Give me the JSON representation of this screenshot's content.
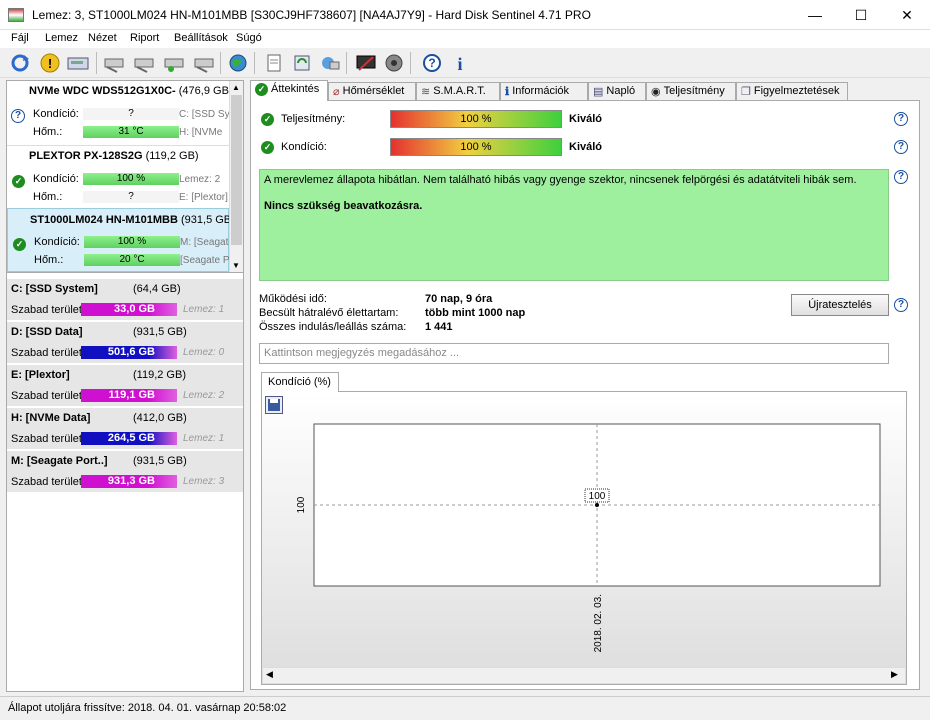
{
  "window": {
    "title": "Lemez: 3, ST1000LM024 HN-M101MBB [S30CJ9HF738607]  [NA4AJ7Y9]  -  Hard Disk Sentinel 4.71 PRO",
    "minimize": "—",
    "maximize": "☐",
    "close": "✕"
  },
  "menu": [
    "Fájl",
    "Lemez",
    "Nézet",
    "Riport",
    "Beállítások",
    "Súgó"
  ],
  "toolbar": [
    "refresh-icon",
    "alert-icon",
    "disk-icon",
    "drive-a-icon",
    "drive-b-icon",
    "drive-c-icon",
    "drive-d-icon",
    "globe-icon",
    "report-icon",
    "sync-icon",
    "share-icon",
    "tools-icon",
    "speaker-icon",
    "help-icon",
    "info-icon"
  ],
  "disks": [
    {
      "name": "NVMe    WDC WDS512G1X0C-",
      "size": "(476,9 GB",
      "condition_label": "Kondíció:",
      "condition": "?",
      "condition_side": "C: [SSD Sys",
      "temp_label": "Hőm.:",
      "temp": "31 °C",
      "temp_side": "H: [NVMe",
      "status": "unknown"
    },
    {
      "name": "PLEXTOR PX-128S2G",
      "size": "(119,2 GB)",
      "condition_label": "Kondíció:",
      "condition": "100 %",
      "condition_side": "Lemez: 2",
      "temp_label": "Hőm.:",
      "temp": "?",
      "temp_side": "E: [Plextor]",
      "status": "ok"
    },
    {
      "name": "ST1000LM024 HN-M101MBB",
      "size": "(931,5 GB)",
      "condition_label": "Kondíció:",
      "condition": "100 %",
      "condition_side": "M: [Seagate",
      "temp_label": "Hőm.:",
      "temp": "20 °C",
      "temp_side": "[Seagate P",
      "status": "ok"
    }
  ],
  "partitions": [
    {
      "name": "C: [SSD System]",
      "size": "(64,4 GB)",
      "label": "Szabad terület",
      "free": "33,0 GB",
      "disk": "Lemez: 1",
      "color": "#d010d0"
    },
    {
      "name": "D: [SSD Data]",
      "size": "(931,5 GB)",
      "label": "Szabad terület",
      "free": "501,6 GB",
      "disk": "Lemez: 0",
      "color": "#1010c0"
    },
    {
      "name": "E: [Plextor]",
      "size": "(119,2 GB)",
      "label": "Szabad terület",
      "free": "119,1 GB",
      "disk": "Lemez: 2",
      "color": "#d010d0"
    },
    {
      "name": "H: [NVMe Data]",
      "size": "(412,0 GB)",
      "label": "Szabad terület",
      "free": "264,5 GB",
      "disk": "Lemez: 1",
      "color": "#1010c0"
    },
    {
      "name": "M: [Seagate Port..]",
      "size": "(931,5 GB)",
      "label": "Szabad terület",
      "free": "931,3 GB",
      "disk": "Lemez: 3",
      "color": "#d010d0"
    }
  ],
  "tabs": [
    {
      "label": "Áttekintés",
      "icon": "check-icon"
    },
    {
      "label": "Hőmérséklet",
      "icon": "thermometer-icon"
    },
    {
      "label": "S.M.A.R.T.",
      "icon": "smart-icon"
    },
    {
      "label": "Információk",
      "icon": "info-icon"
    },
    {
      "label": "Napló",
      "icon": "log-icon"
    },
    {
      "label": "Teljesítmény",
      "icon": "performance-icon"
    },
    {
      "label": "Figyelmeztetések",
      "icon": "alerts-icon"
    }
  ],
  "overview": {
    "performance_label": "Teljesítmény:",
    "performance_value": "100 %",
    "performance_rating": "Kiváló",
    "health_label": "Kondíció:",
    "health_value": "100 %",
    "health_rating": "Kiváló",
    "status_text": "A merevlemez állapota hibátlan. Nem található hibás vagy gyenge szektor, nincsenek felpörgési és adatátviteli hibák sem.",
    "status_action": "Nincs szükség beavatkozásra.",
    "uptime_label": "Működési idő:",
    "uptime": "70 nap, 9 óra",
    "lifetime_label": "Becsült hátralévő élettartam:",
    "lifetime": "több mint 1000 nap",
    "startstop_label": "Összes indulás/leállás száma:",
    "startstop": "1 441",
    "retest_button": "Újratesztelés",
    "note_placeholder": "Kattintson megjegyzés megadásához ...",
    "chart_tab": "Kondíció  (%)"
  },
  "chart_data": {
    "type": "line",
    "title": "",
    "x": [
      "2018. 02. 03."
    ],
    "series": [
      {
        "values": [
          100
        ]
      }
    ],
    "data_labels": [
      "100"
    ],
    "y_tick": "100"
  },
  "statusbar": "Állapot utoljára frissítve: 2018. 04. 01. vasárnap 20:58:02"
}
